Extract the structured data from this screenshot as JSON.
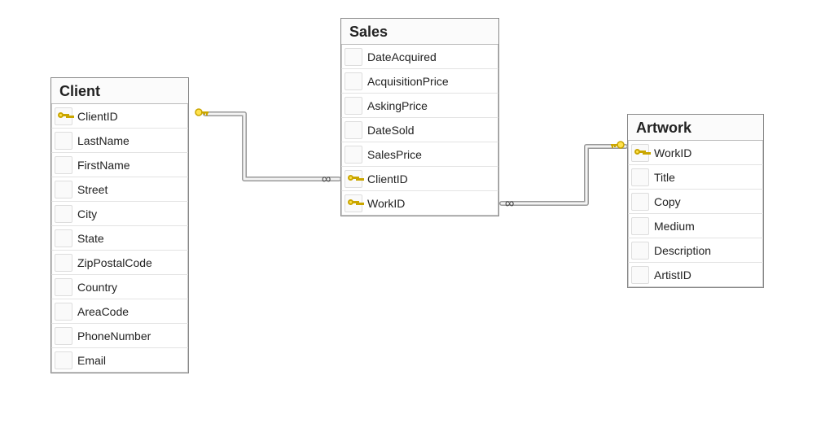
{
  "tables": {
    "client": {
      "title": "Client",
      "columns": [
        {
          "name": "ClientID",
          "pk": true
        },
        {
          "name": "LastName",
          "pk": false
        },
        {
          "name": "FirstName",
          "pk": false
        },
        {
          "name": "Street",
          "pk": false
        },
        {
          "name": "City",
          "pk": false
        },
        {
          "name": "State",
          "pk": false
        },
        {
          "name": "ZipPostalCode",
          "pk": false
        },
        {
          "name": "Country",
          "pk": false
        },
        {
          "name": "AreaCode",
          "pk": false
        },
        {
          "name": "PhoneNumber",
          "pk": false
        },
        {
          "name": "Email",
          "pk": false
        }
      ]
    },
    "sales": {
      "title": "Sales",
      "columns": [
        {
          "name": "DateAcquired",
          "pk": false
        },
        {
          "name": "AcquisitionPrice",
          "pk": false
        },
        {
          "name": "AskingPrice",
          "pk": false
        },
        {
          "name": "DateSold",
          "pk": false
        },
        {
          "name": "SalesPrice",
          "pk": false
        },
        {
          "name": "ClientID",
          "pk": true
        },
        {
          "name": "WorkID",
          "pk": true
        }
      ]
    },
    "artwork": {
      "title": "Artwork",
      "columns": [
        {
          "name": "WorkID",
          "pk": true
        },
        {
          "name": "Title",
          "pk": false
        },
        {
          "name": "Copy",
          "pk": false
        },
        {
          "name": "Medium",
          "pk": false
        },
        {
          "name": "Description",
          "pk": false
        },
        {
          "name": "ArtistID",
          "pk": false
        }
      ]
    }
  },
  "relationships": [
    {
      "from": "Client.ClientID",
      "to": "Sales.ClientID",
      "from_card": "1",
      "to_card": "many"
    },
    {
      "from": "Artwork.WorkID",
      "to": "Sales.WorkID",
      "from_card": "1",
      "to_card": "many"
    }
  ],
  "colors": {
    "key": "#ffe24d",
    "key_outline": "#caa600",
    "pipe": "#999999"
  }
}
